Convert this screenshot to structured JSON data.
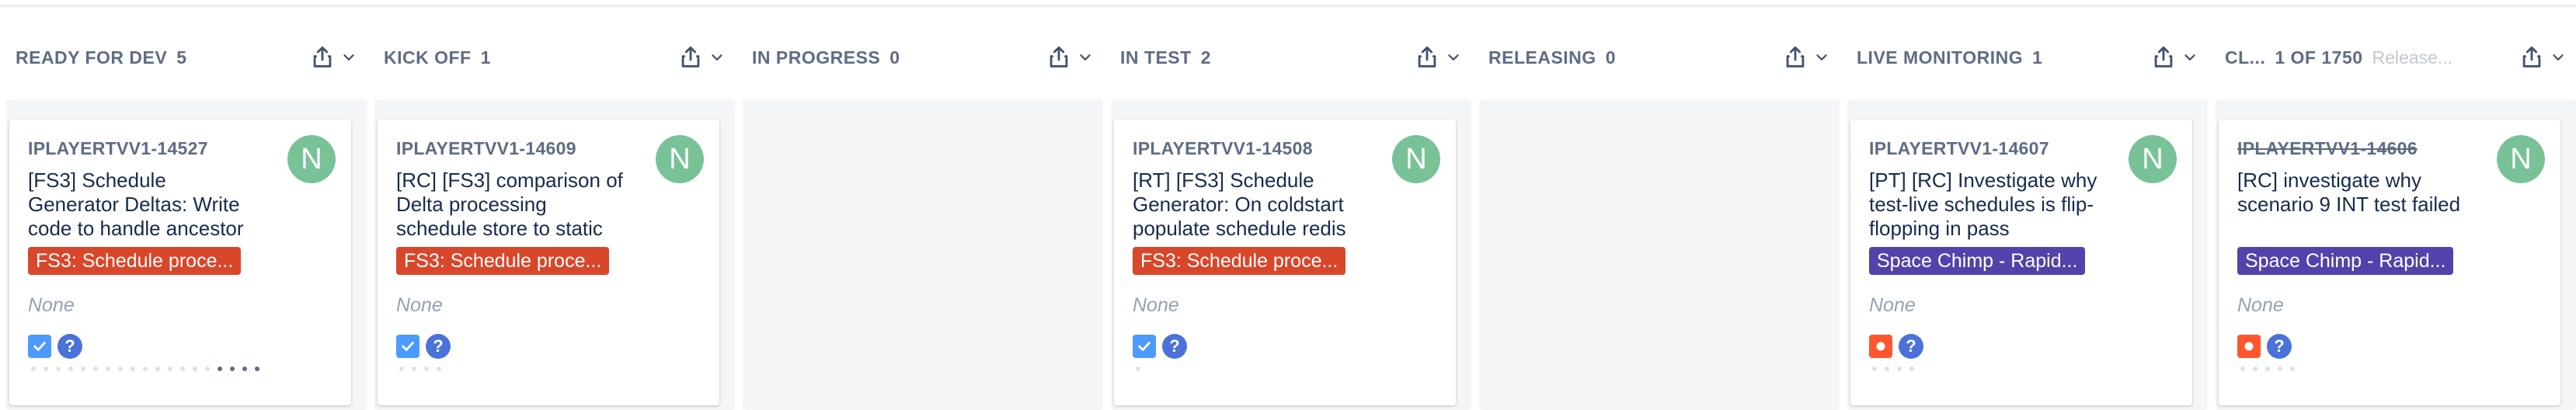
{
  "colors": {
    "header_text": "#5e6c84",
    "column_bg": "#f4f5f7",
    "avatar": "#79c298",
    "epic_fs3": "#d9472b",
    "epic_space_chimp": "#5243aa",
    "story_type": "#4c9aff",
    "bug_type": "#ff5630",
    "priority": "#4a72d8"
  },
  "columns": [
    {
      "title": "READY FOR DEV",
      "count": "5",
      "column_actions": [
        "export-icon",
        "chevron-down-icon"
      ],
      "card": {
        "key": "IPLAYERTVV1-14527",
        "avatar": "N",
        "summary": "[FS3] Schedule Generator Deltas: Write code to handle ancestor",
        "epic": "FS3: Schedule proce...",
        "fix_version": "None",
        "issue_type": "story",
        "priority_glyph": "?"
      }
    },
    {
      "title": "KICK OFF",
      "count": "1",
      "column_actions": [
        "export-icon",
        "chevron-down-icon"
      ],
      "card": {
        "key": "IPLAYERTVV1-14609",
        "avatar": "N",
        "summary": "[RC] [FS3] comparison of Delta processing schedule store to static",
        "epic": "FS3: Schedule proce...",
        "fix_version": "None",
        "issue_type": "story",
        "priority_glyph": "?"
      }
    },
    {
      "title": "IN PROGRESS",
      "count": "0",
      "column_actions": [
        "export-icon",
        "chevron-down-icon"
      ]
    },
    {
      "title": "IN TEST",
      "count": "2",
      "column_actions": [
        "export-icon",
        "chevron-down-icon"
      ],
      "card": {
        "key": "IPLAYERTVV1-14508",
        "avatar": "N",
        "summary": "[RT] [FS3] Schedule Generator: On coldstart populate schedule redis",
        "epic": "FS3: Schedule proce...",
        "fix_version": "None",
        "issue_type": "story",
        "priority_glyph": "?"
      }
    },
    {
      "title": "RELEASING",
      "count": "0",
      "column_actions": [
        "export-icon",
        "chevron-down-icon"
      ]
    },
    {
      "title": "LIVE MONITORING",
      "count": "1",
      "column_actions": [
        "export-icon",
        "chevron-down-icon"
      ],
      "card": {
        "key": "IPLAYERTVV1-14607",
        "avatar": "N",
        "summary": "[PT] [RC] Investigate why test-live schedules is flip-flopping in pass",
        "epic": "Space Chimp - Rapid...",
        "fix_version": "None",
        "issue_type": "bug",
        "priority_glyph": "?"
      }
    },
    {
      "title": "CL...",
      "count": "1 OF 1750",
      "placeholder": "Release...",
      "column_actions": [
        "export-icon",
        "chevron-down-icon"
      ],
      "card": {
        "key": "IPLAYERTVV1-14606",
        "avatar": "N",
        "summary": "[RC] investigate why scenario 9 INT test failed",
        "epic": "Space Chimp - Rapid...",
        "fix_version": "None",
        "issue_type": "bug",
        "priority_glyph": "?"
      }
    }
  ]
}
